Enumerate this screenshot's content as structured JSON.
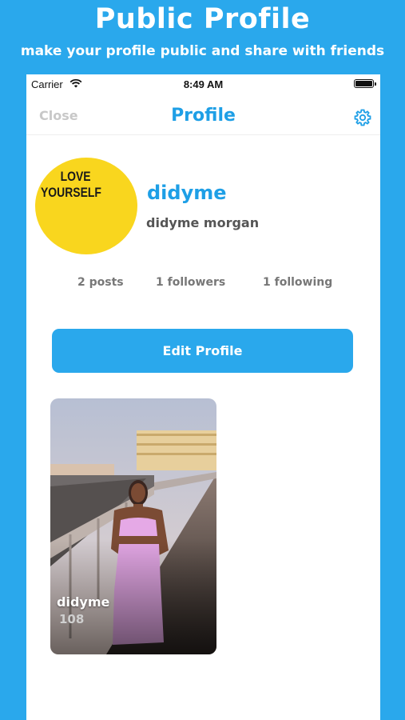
{
  "banner": {
    "title": "Public Profile",
    "subtitle": "make your profile public and share  with friends"
  },
  "status_bar": {
    "carrier": "Carrier",
    "time": "8:49 AM"
  },
  "nav": {
    "close_label": "Close",
    "title": "Profile",
    "settings_icon": "gear-icon"
  },
  "profile": {
    "avatar_text_line1": "LOVE",
    "avatar_text_line2": "YOURSELF",
    "username": "didyme",
    "full_name": "didyme morgan",
    "stats": {
      "posts": "2 posts",
      "followers": "1 followers",
      "following": "1 following"
    },
    "edit_button_label": "Edit Profile"
  },
  "posts": [
    {
      "user": "didyme",
      "count": "108"
    }
  ],
  "colors": {
    "accent": "#2aa8ec",
    "title_blue": "#1e9fe6",
    "avatar_yellow": "#f9d61e"
  }
}
